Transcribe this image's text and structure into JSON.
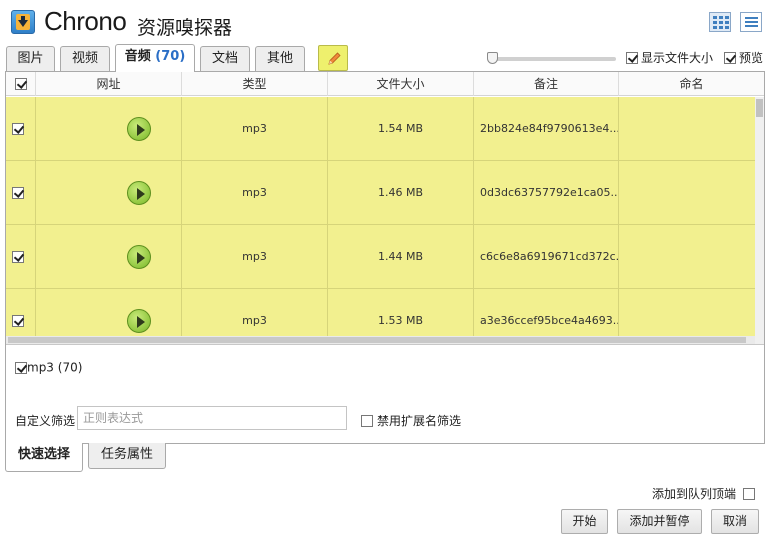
{
  "header": {
    "title": "Chrono",
    "subtitle": "资源嗅探器"
  },
  "tabs": [
    {
      "label": "图片",
      "active": false
    },
    {
      "label": "视频",
      "active": false
    },
    {
      "label": "音频",
      "count": "(70)",
      "active": true
    },
    {
      "label": "文档",
      "active": false
    },
    {
      "label": "其他",
      "active": false
    }
  ],
  "toolbar": {
    "zoom_level": 0,
    "show_size_label": "显示文件大小",
    "show_size_checked": true,
    "preview_label": "预览",
    "preview_checked": true
  },
  "table": {
    "columns": [
      "网址",
      "类型",
      "文件大小",
      "备注",
      "命名"
    ],
    "header_checked": true,
    "rows": [
      {
        "checked": true,
        "type": "mp3",
        "size": "1.54 MB",
        "note": "2bb824e84f9790613e4...",
        "name": ""
      },
      {
        "checked": true,
        "type": "mp3",
        "size": "1.46 MB",
        "note": "0d3dc63757792e1ca05...",
        "name": ""
      },
      {
        "checked": true,
        "type": "mp3",
        "size": "1.44 MB",
        "note": "c6c6e8a6919671cd372c...",
        "name": ""
      },
      {
        "checked": true,
        "type": "mp3",
        "size": "1.53 MB",
        "note": "a3e36ccef95bce4a4693...",
        "name": ""
      }
    ],
    "row_highlight_color": "#f2f08f"
  },
  "filters": {
    "type_chip": "mp3 (70)",
    "custom_label": "自定义筛选",
    "regex_placeholder": "正则表达式",
    "regex_value": "",
    "ext_label": "禁用扩展名筛选",
    "ext_checked": false
  },
  "bottom_tabs": {
    "quick": "快速选择",
    "props": "任务属性"
  },
  "footer": {
    "queue_label": "添加到队列顶端",
    "queue_checked": false,
    "start": "开始",
    "add_pause": "添加并暂停",
    "cancel": "取消"
  }
}
